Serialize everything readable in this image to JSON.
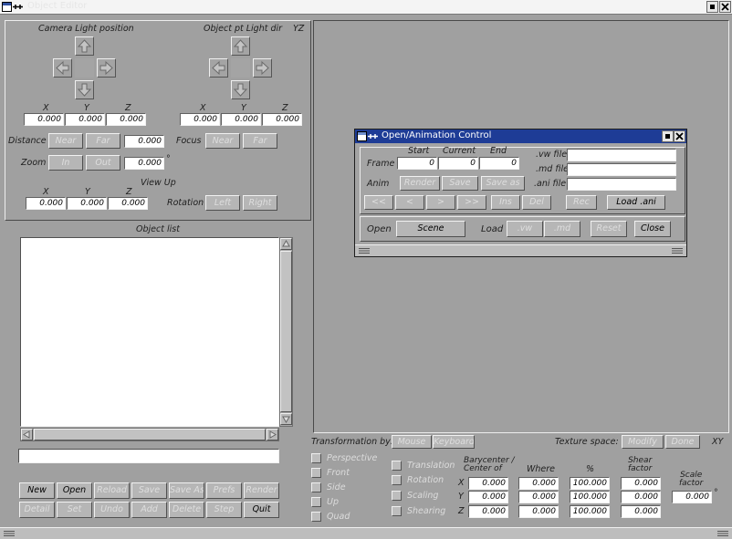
{
  "window": {
    "title": "Object Editor"
  },
  "camera": {
    "title": "Camera  Light  position",
    "xyz_labels": [
      "X",
      "Y",
      "Z"
    ],
    "xyz_values": [
      "0.000",
      "0.000",
      "0.000"
    ]
  },
  "objectpt": {
    "title": "Object pt  Light dir",
    "plane": "YZ",
    "xyz_labels": [
      "X",
      "Y",
      "Z"
    ],
    "xyz_values": [
      "0.000",
      "0.000",
      "0.000"
    ]
  },
  "distance": {
    "label": "Distance",
    "near": "Near",
    "far": "Far",
    "value": "0.000"
  },
  "focus": {
    "label": "Focus",
    "near": "Near",
    "far": "Far"
  },
  "zoom": {
    "label": "Zoom",
    "in": "In",
    "out": "Out",
    "value": "0.000",
    "unit": "°"
  },
  "viewup": {
    "label": "View Up",
    "xyz_labels": [
      "X",
      "Y",
      "Z"
    ],
    "xyz_values": [
      "0.000",
      "0.000",
      "0.000"
    ]
  },
  "rotation": {
    "label": "Rotation",
    "left": "Left",
    "right": "Right"
  },
  "objectlist": {
    "title": "Object list",
    "name_value": ""
  },
  "buttons": {
    "row1": [
      "New",
      "Open",
      "Reload",
      "Save",
      "Save As",
      "Prefs",
      "Render"
    ],
    "row2": [
      "Detail",
      "Set",
      "Undo",
      "Add",
      "Delete",
      "Step",
      "Quit"
    ]
  },
  "transformation": {
    "label": "Transformation by:",
    "mouse": "Mouse",
    "keyboard": "Keyboard"
  },
  "texture": {
    "label": "Texture space:",
    "modify": "Modify",
    "done": "Done",
    "plane": "XY"
  },
  "views": [
    "Perspective",
    "Front",
    "Side",
    "Up",
    "Quad"
  ],
  "modes": [
    "Translation",
    "Rotation",
    "Scaling",
    "Shearing"
  ],
  "columns": {
    "bary": "Barycenter /\nCenter of",
    "where": "Where",
    "percent": "%",
    "shear": "Shear\nfactor",
    "scale": "Scale\nfactor"
  },
  "axes": [
    "X",
    "Y",
    "Z"
  ],
  "grid": {
    "bary": [
      "0.000",
      "0.000",
      "0.000"
    ],
    "where": [
      "0.000",
      "0.000",
      "0.000"
    ],
    "percent": [
      "100.000",
      "100.000",
      "100.000"
    ],
    "shear": [
      "0.000",
      "0.000",
      "0.000"
    ],
    "scale": "0.000",
    "scale_unit": "°"
  },
  "dialog": {
    "title": "Open/Animation Control",
    "frame_label": "Frame",
    "start": "Start",
    "current": "Current",
    "end": "End",
    "start_val": "0",
    "current_val": "0",
    "end_val": "0",
    "vw_label": ".vw file",
    "md_label": ".md file",
    "ani_label": ".ani file",
    "vw_val": "",
    "md_val": "",
    "ani_val": "",
    "anim_label": "Anim",
    "render": "Render",
    "save": "Save",
    "save_as": "Save as",
    "nav": [
      "<<",
      "<",
      ">",
      ">>"
    ],
    "ins": "Ins",
    "del": "Del",
    "rec": "Rec",
    "load_ani": "Load .ani",
    "open_label": "Open",
    "scene": "Scene",
    "load_label": "Load",
    "vw": ".vw",
    "md": ".md",
    "reset": "Reset",
    "close": "Close"
  },
  "colors": {
    "titlebar": "#1e3c96",
    "background": "#a0a0a0",
    "button": "#b6b6b6"
  }
}
